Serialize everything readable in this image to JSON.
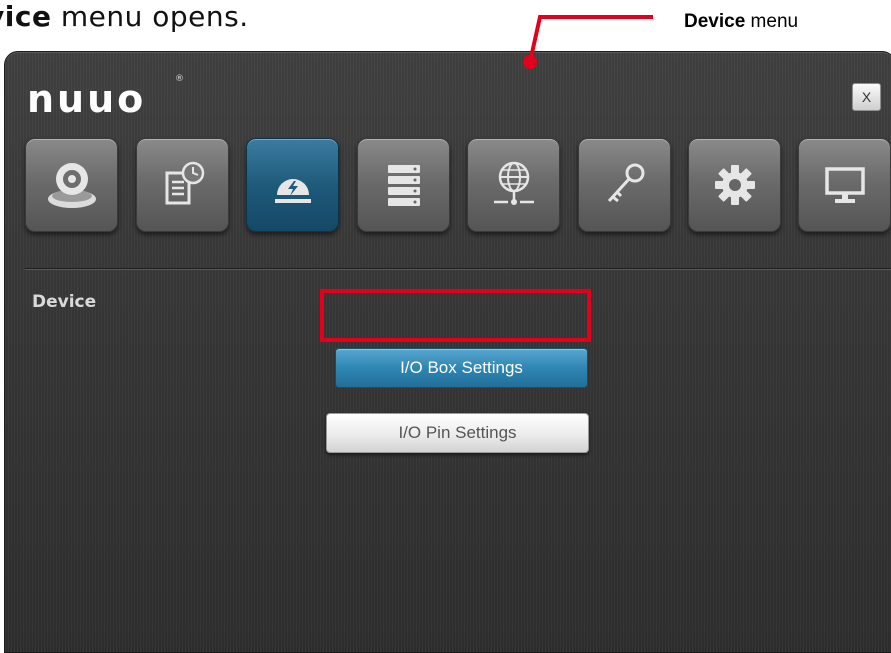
{
  "caption": {
    "bold": "vice",
    "rest": " menu opens."
  },
  "callout": {
    "bold": "Device",
    "rest": " menu",
    "color": "#e4001b"
  },
  "app": {
    "logo": "nuuo",
    "logo_mark": "®",
    "close_label": "X",
    "section_title": "Device",
    "nav_tabs": [
      {
        "icon": "camera-icon",
        "active": false
      },
      {
        "icon": "schedule-document-icon",
        "active": false
      },
      {
        "icon": "alarm-device-icon",
        "active": true
      },
      {
        "icon": "storage-server-icon",
        "active": false
      },
      {
        "icon": "network-globe-icon",
        "active": false
      },
      {
        "icon": "key-icon",
        "active": false
      },
      {
        "icon": "gear-icon",
        "active": false
      },
      {
        "icon": "monitor-icon",
        "active": false
      }
    ],
    "buttons": {
      "io_box": "I/O Box Settings",
      "io_pin": "I/O Pin Settings"
    },
    "accent_color": "#2f86b3"
  }
}
